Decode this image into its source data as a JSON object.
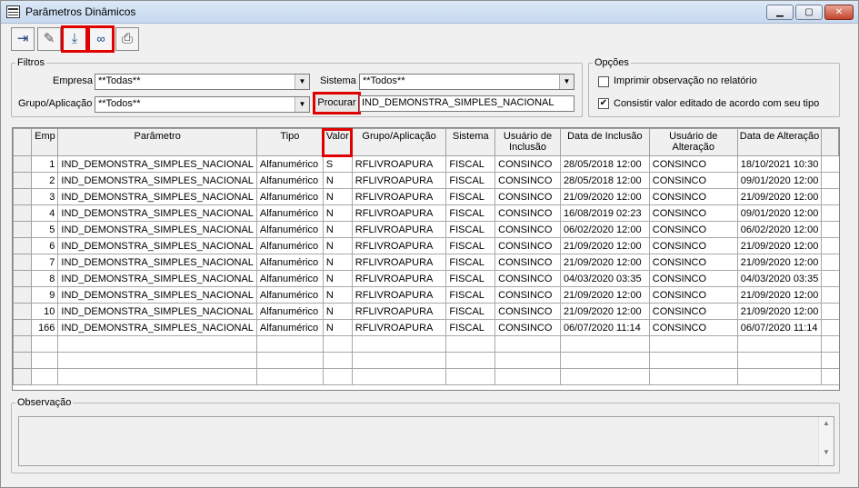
{
  "window": {
    "title": "Parâmetros Dinâmicos",
    "min_glyph": "▁",
    "max_glyph": "▢",
    "close_glyph": "✕"
  },
  "toolbar": {
    "buttons": [
      {
        "name": "exit",
        "icon": "exit-door-icon",
        "glyph": "⇥"
      },
      {
        "name": "clear",
        "icon": "eraser-icon",
        "glyph": "✎"
      },
      {
        "name": "import",
        "icon": "import-icon",
        "glyph": "⤓",
        "highlighted": true
      },
      {
        "name": "search",
        "icon": "binoculars-icon",
        "glyph": "∞",
        "highlighted": true
      },
      {
        "name": "print",
        "icon": "printer-icon",
        "glyph": "⎙"
      }
    ]
  },
  "filtros": {
    "legend": "Filtros",
    "empresa_label": "Empresa",
    "empresa_value": "**Todas**",
    "sistema_label": "Sistema",
    "sistema_value": "**Todos**",
    "grupo_label": "Grupo/Aplicação",
    "grupo_value": "**Todos**",
    "procurar_label": "Procurar",
    "search_value": "IND_DEMONSTRA_SIMPLES_NACIONAL"
  },
  "opcoes": {
    "legend": "Opções",
    "opt1_label": "Imprimir observação no relatório",
    "opt1_checked": false,
    "opt2_label": "Consistir valor editado de acordo com seu tipo",
    "opt2_checked": true,
    "check_glyph": "✔"
  },
  "grid": {
    "columns": [
      "Emp",
      "Parâmetro",
      "Tipo",
      "Valor",
      "Grupo/Aplicação",
      "Sistema",
      "Usuário de Inclusão",
      "Data de Inclusão",
      "Usuário de Alteração",
      "Data de Alteração"
    ],
    "rows": [
      [
        "1",
        "IND_DEMONSTRA_SIMPLES_NACIONAL",
        "Alfanumérico",
        "S",
        "RFLIVROAPURA",
        "FISCAL",
        "CONSINCO",
        "28/05/2018 12:00",
        "CONSINCO",
        "18/10/2021 10:30"
      ],
      [
        "2",
        "IND_DEMONSTRA_SIMPLES_NACIONAL",
        "Alfanumérico",
        "N",
        "RFLIVROAPURA",
        "FISCAL",
        "CONSINCO",
        "28/05/2018 12:00",
        "CONSINCO",
        "09/01/2020 12:00"
      ],
      [
        "3",
        "IND_DEMONSTRA_SIMPLES_NACIONAL",
        "Alfanumérico",
        "N",
        "RFLIVROAPURA",
        "FISCAL",
        "CONSINCO",
        "21/09/2020 12:00",
        "CONSINCO",
        "21/09/2020 12:00"
      ],
      [
        "4",
        "IND_DEMONSTRA_SIMPLES_NACIONAL",
        "Alfanumérico",
        "N",
        "RFLIVROAPURA",
        "FISCAL",
        "CONSINCO",
        "16/08/2019 02:23",
        "CONSINCO",
        "09/01/2020 12:00"
      ],
      [
        "5",
        "IND_DEMONSTRA_SIMPLES_NACIONAL",
        "Alfanumérico",
        "N",
        "RFLIVROAPURA",
        "FISCAL",
        "CONSINCO",
        "06/02/2020 12:00",
        "CONSINCO",
        "06/02/2020 12:00"
      ],
      [
        "6",
        "IND_DEMONSTRA_SIMPLES_NACIONAL",
        "Alfanumérico",
        "N",
        "RFLIVROAPURA",
        "FISCAL",
        "CONSINCO",
        "21/09/2020 12:00",
        "CONSINCO",
        "21/09/2020 12:00"
      ],
      [
        "7",
        "IND_DEMONSTRA_SIMPLES_NACIONAL",
        "Alfanumérico",
        "N",
        "RFLIVROAPURA",
        "FISCAL",
        "CONSINCO",
        "21/09/2020 12:00",
        "CONSINCO",
        "21/09/2020 12:00"
      ],
      [
        "8",
        "IND_DEMONSTRA_SIMPLES_NACIONAL",
        "Alfanumérico",
        "N",
        "RFLIVROAPURA",
        "FISCAL",
        "CONSINCO",
        "04/03/2020 03:35",
        "CONSINCO",
        "04/03/2020 03:35"
      ],
      [
        "9",
        "IND_DEMONSTRA_SIMPLES_NACIONAL",
        "Alfanumérico",
        "N",
        "RFLIVROAPURA",
        "FISCAL",
        "CONSINCO",
        "21/09/2020 12:00",
        "CONSINCO",
        "21/09/2020 12:00"
      ],
      [
        "10",
        "IND_DEMONSTRA_SIMPLES_NACIONAL",
        "Alfanumérico",
        "N",
        "RFLIVROAPURA",
        "FISCAL",
        "CONSINCO",
        "21/09/2020 12:00",
        "CONSINCO",
        "21/09/2020 12:00"
      ],
      [
        "166",
        "IND_DEMONSTRA_SIMPLES_NACIONAL",
        "Alfanumérico",
        "N",
        "RFLIVROAPURA",
        "FISCAL",
        "CONSINCO",
        "06/07/2020 11:14",
        "CONSINCO",
        "06/07/2020 11:14"
      ]
    ],
    "empty_rows": 3
  },
  "observacao": {
    "legend": "Observação",
    "value": "",
    "scroll_up_glyph": "▲",
    "scroll_down_glyph": "▼"
  },
  "colors": {
    "highlight": "#e00000",
    "title_bar": "#c6d9f0"
  }
}
